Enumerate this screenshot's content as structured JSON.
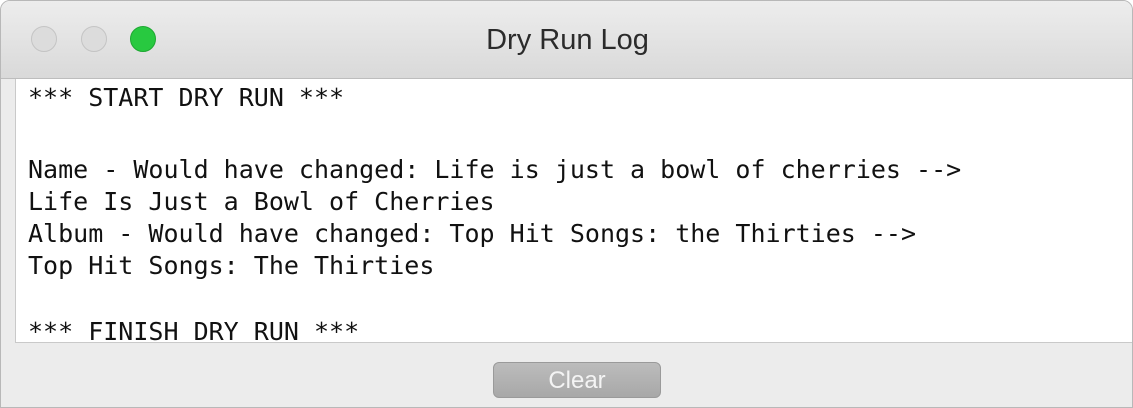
{
  "window": {
    "title": "Dry Run Log"
  },
  "log": {
    "lines": [
      "*** START DRY RUN ***",
      "",
      "Name - Would have changed: Life is just a bowl of cherries -->",
      "Life Is Just a Bowl of Cherries",
      "Album - Would have changed: Top Hit Songs: the Thirties -->",
      "Top Hit Songs: The Thirties",
      "",
      "*** FINISH DRY RUN ***"
    ]
  },
  "footer": {
    "clear_label": "Clear"
  },
  "colors": {
    "zoom_button": "#28c940",
    "inactive_button": "#dcdcdc",
    "button_disabled": "#b2b2b2"
  },
  "icons": {
    "close": "close-icon",
    "minimize": "minimize-icon",
    "zoom": "zoom-icon"
  }
}
